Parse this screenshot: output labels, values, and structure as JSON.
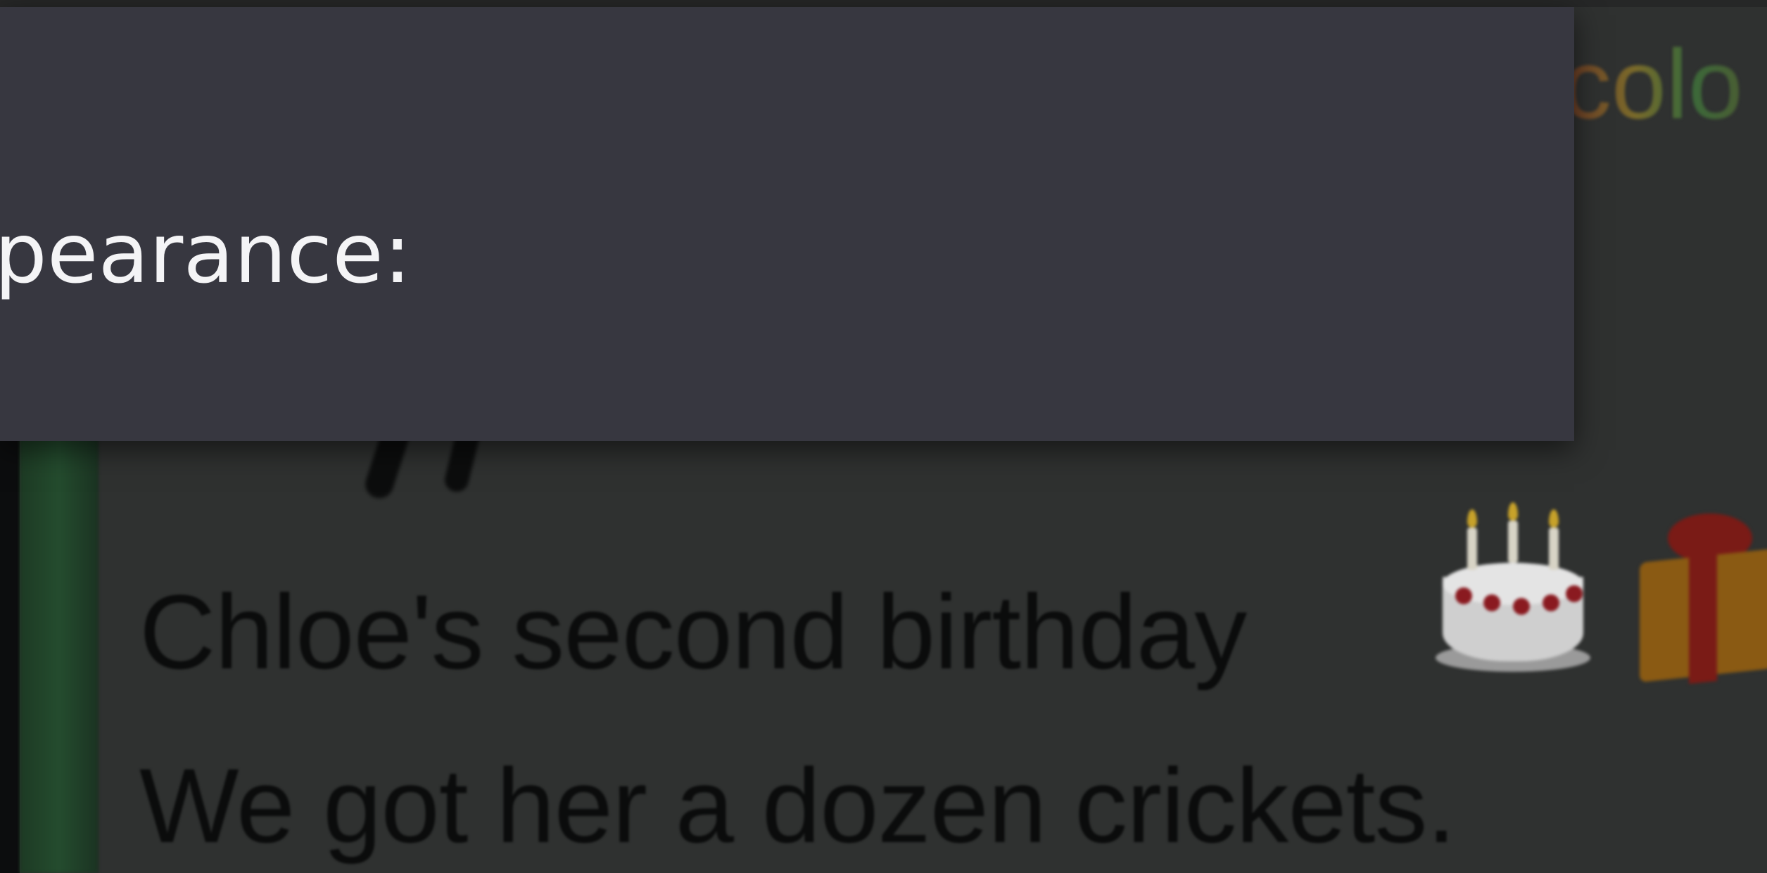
{
  "dialog": {
    "label_fragment": "pearance:"
  },
  "post": {
    "header_fragment": "colo",
    "lines": [
      "Chloe's second birthday",
      "We got her a dozen crickets."
    ],
    "emojis": [
      "birthday-cake-icon",
      "gift-icon"
    ]
  },
  "colors": {
    "dialog_bg": "#373740",
    "dialog_text": "#f4f4f6",
    "side_bar_accent": "#244c2e"
  }
}
